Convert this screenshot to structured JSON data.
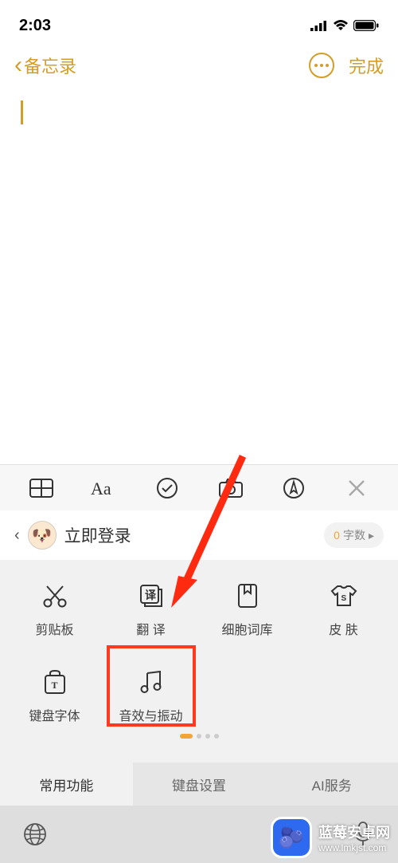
{
  "status": {
    "time": "2:03"
  },
  "nav": {
    "back": "备忘录",
    "done": "完成"
  },
  "login": {
    "label": "立即登录",
    "wordcount_prefix": "0",
    "wordcount_label": "字数"
  },
  "grid": {
    "row1": [
      {
        "label": "剪贴板"
      },
      {
        "label": "翻 译"
      },
      {
        "label": "细胞词库"
      },
      {
        "label": "皮 肤"
      }
    ],
    "row2": [
      {
        "label": "键盘字体"
      },
      {
        "label": "音效与振动"
      }
    ]
  },
  "tabs": {
    "t1": "常用功能",
    "t2": "键盘设置",
    "t3": "AI服务"
  },
  "watermark": {
    "title": "蓝莓安卓网",
    "url": "www.lmkjst.com"
  }
}
